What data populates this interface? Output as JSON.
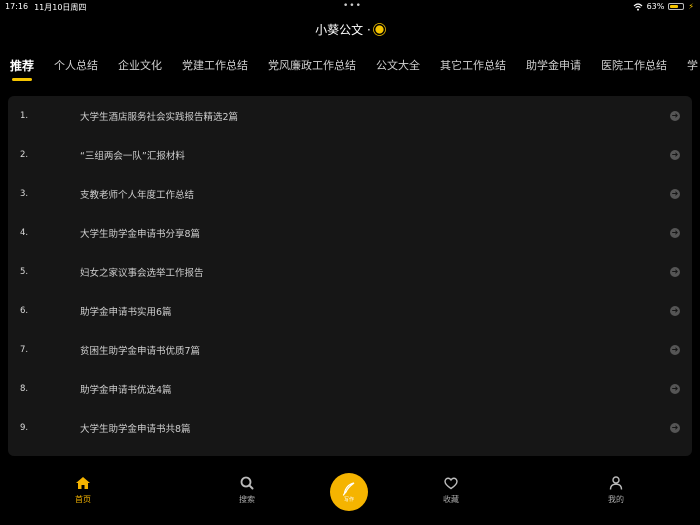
{
  "status_bar": {
    "time": "17:16",
    "date": "11月10日周四",
    "dots": "•••",
    "battery_text": "63%",
    "battery_level": 0.63
  },
  "header": {
    "title": "小葵公文 ·"
  },
  "tabs": [
    {
      "label": "推荐",
      "active": true
    },
    {
      "label": "个人总结",
      "active": false
    },
    {
      "label": "企业文化",
      "active": false
    },
    {
      "label": "党建工作总结",
      "active": false
    },
    {
      "label": "党风廉政工作总结",
      "active": false
    },
    {
      "label": "公文大全",
      "active": false
    },
    {
      "label": "其它工作总结",
      "active": false
    },
    {
      "label": "助学金申请",
      "active": false
    },
    {
      "label": "医院工作总结",
      "active": false
    },
    {
      "label": "学",
      "active": false
    }
  ],
  "list": [
    {
      "num": "1.",
      "text": "大学生酒店服务社会实践报告精选2篇"
    },
    {
      "num": "2.",
      "text": "“三组两会一队”汇报材料"
    },
    {
      "num": "3.",
      "text": "支教老师个人年度工作总结"
    },
    {
      "num": "4.",
      "text": "大学生助学金申请书分享8篇"
    },
    {
      "num": "5.",
      "text": "妇女之家议事会选举工作报告"
    },
    {
      "num": "6.",
      "text": "助学金申请书实用6篇"
    },
    {
      "num": "7.",
      "text": "贫困生助学金申请书优质7篇"
    },
    {
      "num": "8.",
      "text": "助学金申请书优选4篇"
    },
    {
      "num": "9.",
      "text": "大学生助学金申请书共8篇"
    }
  ],
  "bottom_nav": {
    "home": "首页",
    "search": "搜索",
    "center": "写作",
    "favorites": "收藏",
    "mine": "我的"
  },
  "colors": {
    "accent": "#f5b400",
    "background": "#000000",
    "card": "#161616"
  }
}
